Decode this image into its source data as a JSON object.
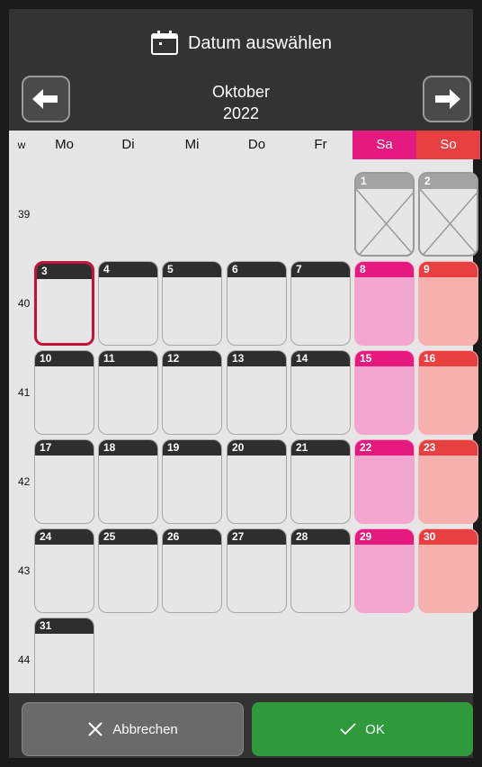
{
  "header": {
    "title": "Datum auswählen",
    "month": "Oktober",
    "year": "2022",
    "prev_icon": "arrow-left-icon",
    "next_icon": "arrow-right-icon",
    "calendar_icon": "calendar-icon"
  },
  "weekdays": {
    "week_label": "w",
    "mo": "Mo",
    "di": "Di",
    "mi": "Mi",
    "do": "Do",
    "fr": "Fr",
    "sa": "Sa",
    "so": "So"
  },
  "weeks": [
    "39",
    "40",
    "41",
    "42",
    "43",
    "44"
  ],
  "days": {
    "d1": "1",
    "d2": "2",
    "d3": "3",
    "d4": "4",
    "d5": "5",
    "d6": "6",
    "d7": "7",
    "d8": "8",
    "d9": "9",
    "d10": "10",
    "d11": "11",
    "d12": "12",
    "d13": "13",
    "d14": "14",
    "d15": "15",
    "d16": "16",
    "d17": "17",
    "d18": "18",
    "d19": "19",
    "d20": "20",
    "d21": "21",
    "d22": "22",
    "d23": "23",
    "d24": "24",
    "d25": "25",
    "d26": "26",
    "d27": "27",
    "d28": "28",
    "d29": "29",
    "d30": "30",
    "d31": "31"
  },
  "selected_day": "3",
  "footer": {
    "cancel_label": "Abbrechen",
    "ok_label": "OK"
  },
  "colors": {
    "saturday": "#e6197f",
    "sunday": "#e84040",
    "ok": "#2e9a3c",
    "selected_border": "#c4123a"
  }
}
